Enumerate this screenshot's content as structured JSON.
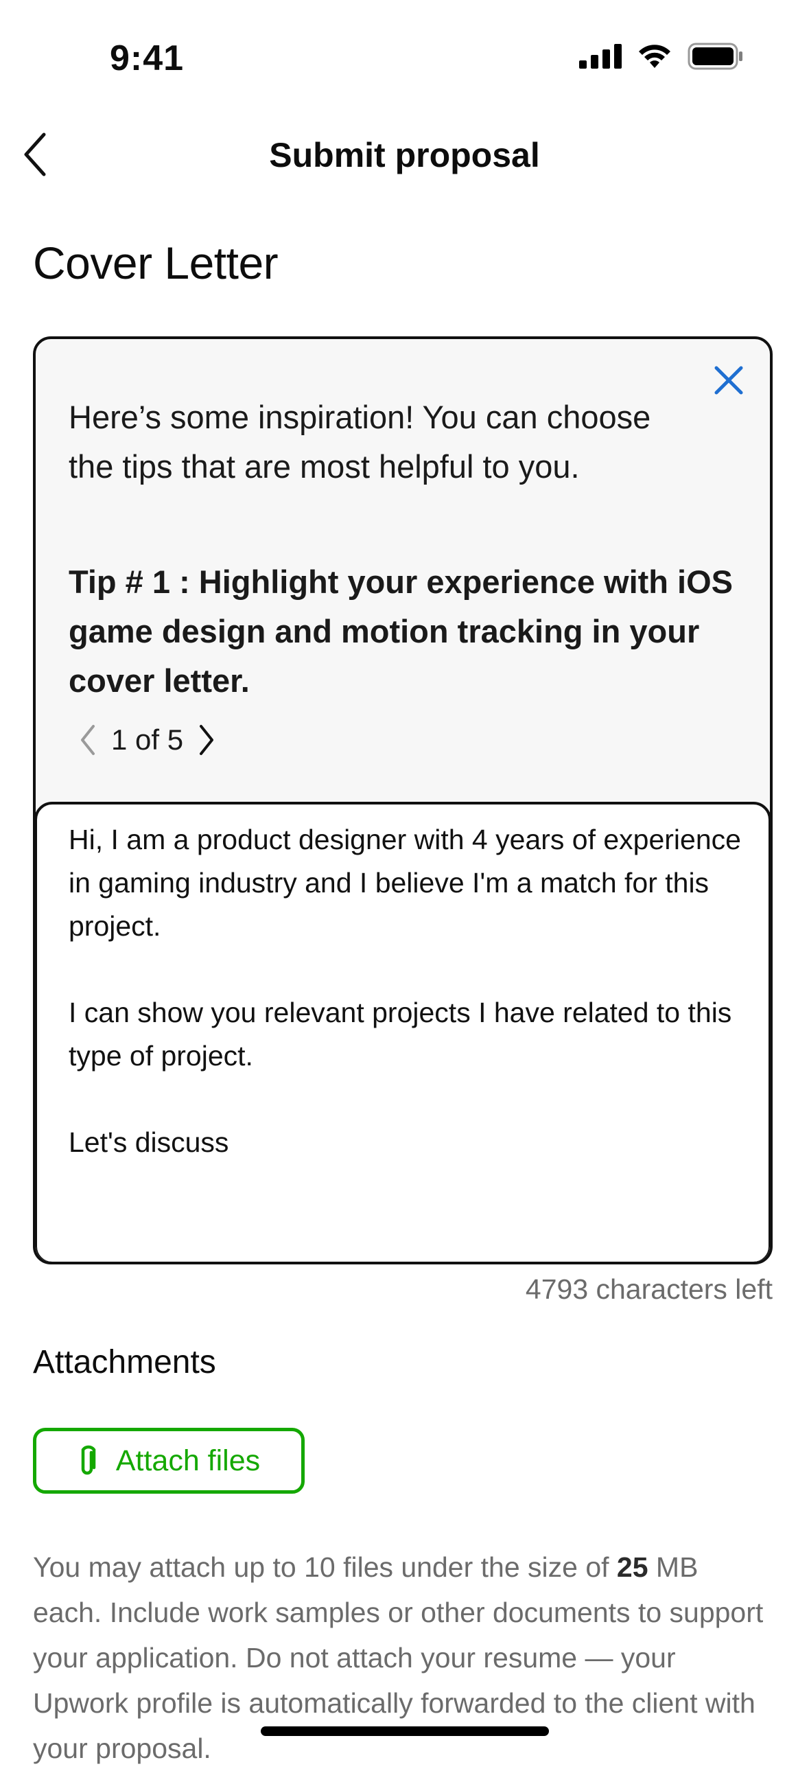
{
  "status_bar": {
    "time": "9:41"
  },
  "nav": {
    "title": "Submit proposal"
  },
  "page": {
    "title": "Cover Letter"
  },
  "tips": {
    "intro": "Here’s some inspiration! You can choose the tips that are most helpful to you.",
    "tip_text": "Tip # 1 : Highlight your experience with iOS game design and motion tracking in your cover letter.",
    "pager": "1 of 5"
  },
  "cover_letter": {
    "value": "Hi, I am a product designer with 4 years of experience in gaming industry and I believe I'm a match for this project.\n\nI can show you relevant projects I have related to this type of project.\n\nLet's discuss"
  },
  "chars_left": "4793 characters left",
  "attachments": {
    "heading": "Attachments",
    "button_label": "Attach files",
    "note_part1": "You may attach up to 10 files under the size of ",
    "note_size": "25",
    "note_part2": " MB each. Include work samples or other documents to support your application. Do not attach your resume — your Upwork profile is automatically forwarded to the client with your proposal."
  },
  "colors": {
    "accent_green": "#14a800",
    "close_blue": "#1f6fd1"
  }
}
